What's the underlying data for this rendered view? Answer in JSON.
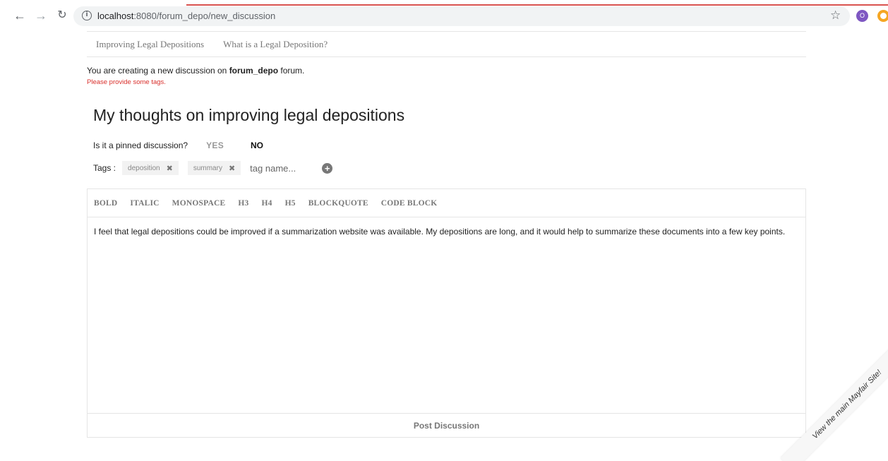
{
  "browser": {
    "url_host": "localhost",
    "url_rest": ":8080/forum_depo/new_discussion",
    "profile_initial": "O"
  },
  "nav": {
    "items": [
      {
        "label": "Improving Legal Depositions"
      },
      {
        "label": "What is a Legal Deposition?"
      }
    ]
  },
  "intro": {
    "prefix": "You are creating a new discussion on ",
    "forum": "forum_depo",
    "suffix": " forum."
  },
  "error": "Please provide some tags.",
  "discussion": {
    "title": "My thoughts on improving legal depositions",
    "pinned_label": "Is it a pinned discussion?",
    "yes": "YES",
    "no": "NO",
    "selected": "NO"
  },
  "tags": {
    "label": "Tags :",
    "items": [
      {
        "label": "deposition"
      },
      {
        "label": "summary"
      }
    ],
    "placeholder": "tag name..."
  },
  "editor": {
    "toolbar": [
      "BOLD",
      "ITALIC",
      "MONOSPACE",
      "H3",
      "H4",
      "H5",
      "BLOCKQUOTE",
      "CODE BLOCK"
    ],
    "body": "I feel that legal depositions could be improved if a summarization website was available. My depositions are long, and it would help to summarize these documents into a few key points.",
    "post_label": "Post Discussion"
  },
  "ribbon": "View the main Mayfair Site!",
  "colors": {
    "error": "#d9302c",
    "ribbon_bg": "#f7f7f7",
    "profile": "#7e57c2",
    "extension": "#f5a623"
  }
}
